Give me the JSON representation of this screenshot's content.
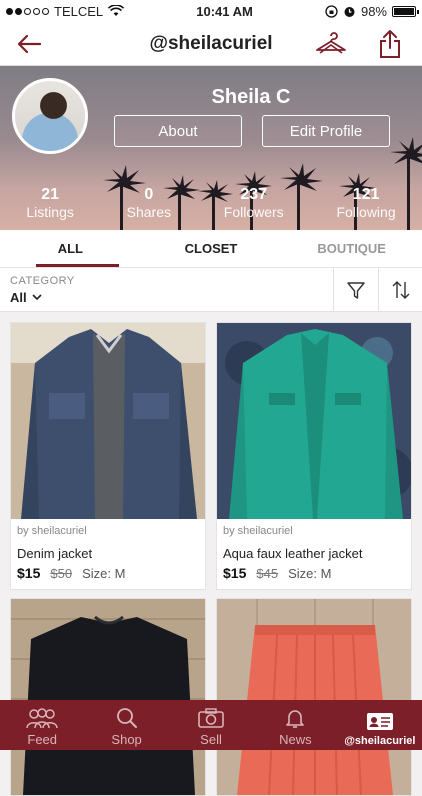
{
  "status_bar": {
    "carrier": "TELCEL",
    "time": "10:41 AM",
    "battery": "98%",
    "battery_level": 0.98
  },
  "nav": {
    "title": "@sheilacuriel",
    "back_icon": "back-arrow-icon",
    "closet_icon": "hanger-icon",
    "share_icon": "share-icon"
  },
  "profile": {
    "name": "Sheila C",
    "about_label": "About",
    "edit_label": "Edit Profile",
    "stats": [
      {
        "num": "21",
        "label": "Listings"
      },
      {
        "num": "0",
        "label": "Shares"
      },
      {
        "num": "237",
        "label": "Followers"
      },
      {
        "num": "121",
        "label": "Following"
      }
    ]
  },
  "tabs": [
    {
      "label": "ALL"
    },
    {
      "label": "CLOSET"
    },
    {
      "label": "BOUTIQUE"
    }
  ],
  "filter": {
    "category_label": "CATEGORY",
    "category_value": "All"
  },
  "listings": [
    {
      "by": "by sheilacuriel",
      "title": "Denim jacket",
      "price": "$15",
      "original": "$50",
      "size": "Size: M"
    },
    {
      "by": "by sheilacuriel",
      "title": "Aqua faux leather jacket",
      "price": "$15",
      "original": "$45",
      "size": "Size: M"
    }
  ],
  "bottom_tabs": [
    {
      "label": "Feed",
      "icon": "people-icon"
    },
    {
      "label": "Shop",
      "icon": "search-icon"
    },
    {
      "label": "Sell",
      "icon": "camera-icon"
    },
    {
      "label": "News",
      "icon": "bell-icon"
    },
    {
      "label": "@sheilacuriel",
      "icon": "profile-card-icon"
    }
  ],
  "colors": {
    "brand": "#7d1f29",
    "accent_underline": "#7f1d2b"
  }
}
